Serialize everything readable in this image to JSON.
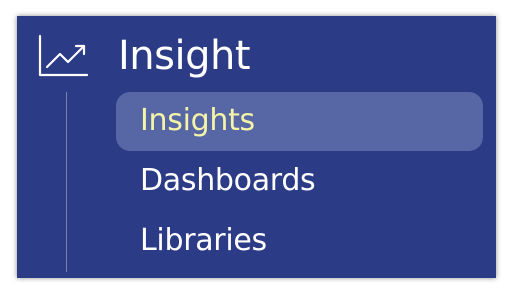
{
  "section": {
    "title": "Insight",
    "icon": "trending-chart-icon"
  },
  "nav": {
    "items": [
      {
        "label": "Insights",
        "active": true
      },
      {
        "label": "Dashboards",
        "active": false
      },
      {
        "label": "Libraries",
        "active": false
      }
    ]
  },
  "colors": {
    "panel_bg": "#2b3b86",
    "active_bg": "#5766a4",
    "active_text": "#f3f4a8",
    "text": "#ffffff"
  }
}
